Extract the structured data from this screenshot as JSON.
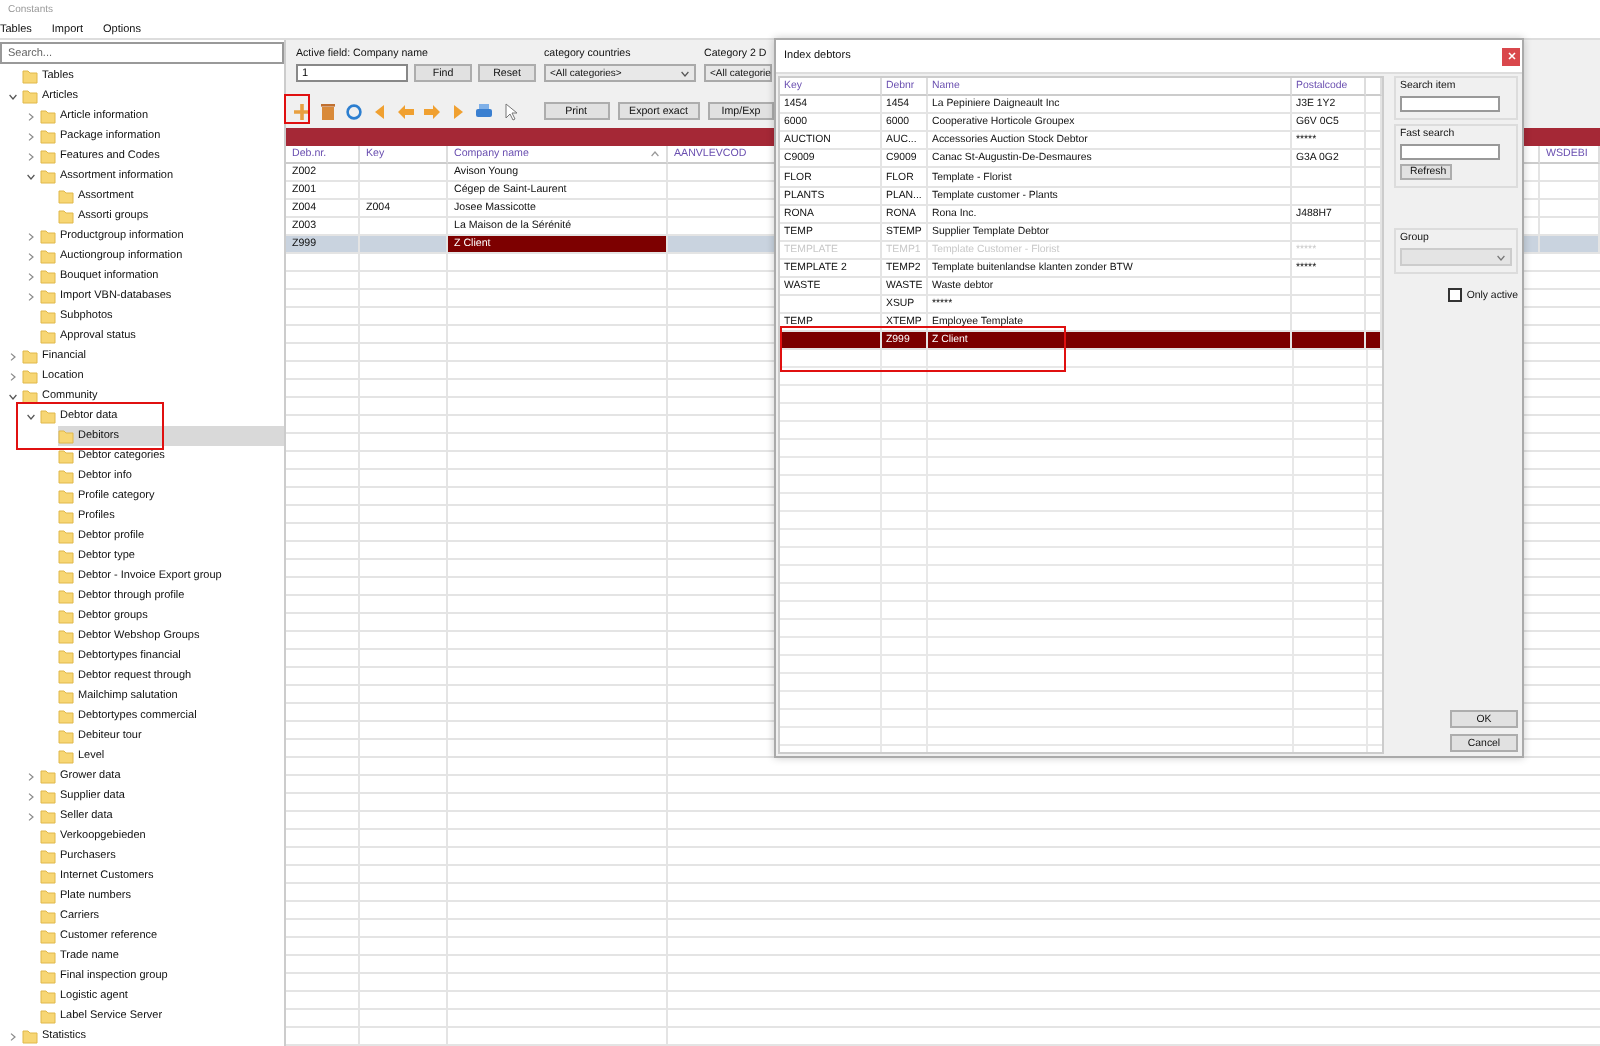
{
  "window": {
    "title": "Constants"
  },
  "menu": [
    "Tables",
    "Import",
    "Options"
  ],
  "sidebar": {
    "search": {
      "placeholder": "Search..."
    },
    "tree": [
      {
        "label": "Tables",
        "selected": false
      },
      {
        "label": "Articles",
        "expanded": true,
        "selected": false,
        "children": [
          {
            "label": "Article information",
            "expanded": false,
            "selected": false
          },
          {
            "label": "Package information",
            "expanded": false,
            "selected": false
          },
          {
            "label": "Features and Codes",
            "expanded": false,
            "selected": false
          },
          {
            "label": "Assortment information",
            "expanded": true,
            "selected": false,
            "children": [
              {
                "label": "Assortment",
                "selected": false
              },
              {
                "label": "Assorti groups",
                "selected": false
              }
            ]
          },
          {
            "label": "Productgroup information",
            "expanded": false,
            "selected": false
          },
          {
            "label": "Auctiongroup information",
            "expanded": false,
            "selected": false
          },
          {
            "label": "Bouquet information",
            "expanded": false,
            "selected": false
          },
          {
            "label": "Import VBN-databases",
            "expanded": false,
            "selected": false
          },
          {
            "label": "Subphotos",
            "selected": false
          },
          {
            "label": "Approval status",
            "selected": false
          }
        ]
      },
      {
        "label": "Financial",
        "expanded": false,
        "selected": false
      },
      {
        "label": "Location",
        "expanded": false,
        "selected": false
      },
      {
        "label": "Community",
        "expanded": true,
        "selected": false,
        "children": [
          {
            "label": "Debtor data",
            "expanded": true,
            "selected": false,
            "children": [
              {
                "label": "Debitors",
                "selected": true
              },
              {
                "label": "Debtor categories",
                "selected": false
              },
              {
                "label": "Debtor info",
                "selected": false
              },
              {
                "label": "Profile category",
                "selected": false
              },
              {
                "label": "Profiles",
                "selected": false
              },
              {
                "label": "Debtor profile",
                "selected": false
              },
              {
                "label": "Debtor type",
                "selected": false
              },
              {
                "label": "Debtor - Invoice Export group",
                "selected": false
              },
              {
                "label": "Debtor through profile",
                "selected": false
              },
              {
                "label": "Debtor groups",
                "selected": false
              },
              {
                "label": "Debtor Webshop Groups",
                "selected": false
              },
              {
                "label": "Debtortypes financial",
                "selected": false
              },
              {
                "label": "Debtor request through",
                "selected": false
              },
              {
                "label": "Mailchimp salutation",
                "selected": false
              },
              {
                "label": "Debtortypes commercial",
                "selected": false
              },
              {
                "label": "Debiteur tour",
                "selected": false
              },
              {
                "label": "Level",
                "selected": false
              }
            ]
          },
          {
            "label": "Grower data",
            "expanded": false,
            "selected": false
          },
          {
            "label": "Supplier data",
            "expanded": false,
            "selected": false
          },
          {
            "label": "Seller data",
            "expanded": false,
            "selected": false
          },
          {
            "label": "Verkoopgebieden",
            "selected": false
          },
          {
            "label": "Purchasers",
            "selected": false
          },
          {
            "label": "Internet Customers",
            "selected": false
          },
          {
            "label": "Plate numbers",
            "selected": false
          },
          {
            "label": "Carriers",
            "selected": false
          },
          {
            "label": "Customer reference",
            "selected": false
          },
          {
            "label": "Trade name",
            "selected": false
          },
          {
            "label": "Final inspection group",
            "selected": false
          },
          {
            "label": "Logistic agent",
            "selected": false
          },
          {
            "label": "Label Service Server",
            "selected": false
          }
        ]
      },
      {
        "label": "Statistics",
        "expanded": false,
        "selected": false
      }
    ]
  },
  "filter": {
    "active_field": "Active field: Company name",
    "value": "1",
    "buttons": [
      "Find",
      "Reset"
    ],
    "groups": [
      {
        "label": "category countries",
        "value": "<All categories>"
      },
      {
        "label": "Category 2 D",
        "value": "<All categorie"
      }
    ]
  },
  "toolbar": {
    "buttons": [
      "Print",
      "Export exact",
      "Imp/Exp"
    ]
  },
  "table": {
    "columns": [
      "Deb.nr.",
      "Key",
      "Company name",
      "AANVLEVCOD",
      "WSDEBI"
    ],
    "rows": [
      {
        "cells": [
          "Z002",
          "",
          "Avison Young",
          "",
          ""
        ],
        "selected": false
      },
      {
        "cells": [
          "Z001",
          "",
          "Cégep de Saint-Laurent",
          "",
          ""
        ],
        "selected": false
      },
      {
        "cells": [
          "Z004",
          "Z004",
          "Josee Massicotte",
          "",
          ""
        ],
        "selected": false
      },
      {
        "cells": [
          "Z003",
          "",
          "La Maison de la Sérénité",
          "",
          ""
        ],
        "selected": false
      },
      {
        "cells": [
          "Z999",
          "",
          "Z Client",
          "",
          ""
        ],
        "selected": true
      }
    ]
  },
  "dialog": {
    "title": "Index debtors",
    "columns": [
      "Key",
      "Debnr",
      "Name",
      "Postalcode"
    ],
    "rows": [
      {
        "cells": [
          "1454",
          "1454",
          "La Pepiniere Daigneault Inc",
          "J3E 1Y2"
        ],
        "selected": false,
        "disabled": false
      },
      {
        "cells": [
          "6000",
          "6000",
          "Cooperative Horticole Groupex",
          "G6V 0C5"
        ],
        "selected": false,
        "disabled": false
      },
      {
        "cells": [
          "AUCTION",
          "AUC...",
          "Accessories Auction Stock Debtor",
          "*****"
        ],
        "selected": false,
        "disabled": false
      },
      {
        "cells": [
          "C9009",
          "C9009",
          "Canac St-Augustin-De-Desmaures",
          "G3A 0G2"
        ],
        "selected": false,
        "disabled": false
      },
      {
        "cells": [
          "FLOR",
          "FLOR",
          "Template - Florist",
          ""
        ],
        "selected": false,
        "disabled": false
      },
      {
        "cells": [
          "PLANTS",
          "PLAN...",
          "Template customer - Plants",
          ""
        ],
        "selected": false,
        "disabled": false
      },
      {
        "cells": [
          "RONA",
          "RONA",
          "Rona Inc.",
          "J488H7"
        ],
        "selected": false,
        "disabled": false
      },
      {
        "cells": [
          "TEMP",
          "STEMP",
          "Supplier Template Debtor",
          ""
        ],
        "selected": false,
        "disabled": false
      },
      {
        "cells": [
          "TEMPLATE",
          "TEMP1",
          "Template Customer - Florist",
          "*****"
        ],
        "selected": false,
        "disabled": true
      },
      {
        "cells": [
          "TEMPLATE 2",
          "TEMP2",
          "Template buitenlandse klanten zonder BTW",
          "*****"
        ],
        "selected": false,
        "disabled": false
      },
      {
        "cells": [
          "WASTE",
          "WASTE",
          "Waste debtor",
          ""
        ],
        "selected": false,
        "disabled": false
      },
      {
        "cells": [
          "",
          "XSUP",
          "*****",
          ""
        ],
        "selected": false,
        "disabled": false
      },
      {
        "cells": [
          "TEMP",
          "XTEMP",
          "Employee Template",
          ""
        ],
        "selected": false,
        "disabled": false
      },
      {
        "cells": [
          "",
          "Z999",
          "Z Client",
          ""
        ],
        "selected": true,
        "disabled": false
      }
    ],
    "search_item": {
      "label": "Search item"
    },
    "fast_search": {
      "label": "Fast search"
    },
    "refresh": "Refresh",
    "group": {
      "label": "Group"
    },
    "only_active": {
      "label": "Only active",
      "checked": false
    },
    "buttons": [
      "OK",
      "Cancel"
    ]
  }
}
